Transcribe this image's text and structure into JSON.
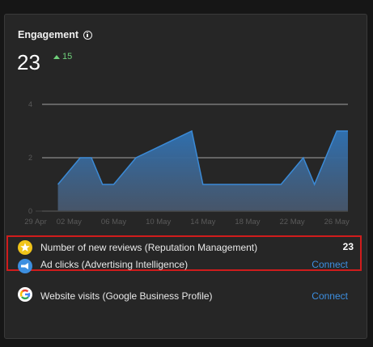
{
  "widget": {
    "title": "Engagement",
    "total": "23",
    "delta": "15",
    "colors": {
      "accent": "#3d8fe0",
      "positive": "#6fcf7a",
      "highlight": "#d01c1c",
      "area": "#2f6fae"
    }
  },
  "chart_data": {
    "type": "area",
    "x": [
      "29 Apr",
      "30 Apr",
      "01 May",
      "02 May",
      "03 May",
      "04 May",
      "05 May",
      "06 May",
      "07 May",
      "08 May",
      "09 May",
      "10 May",
      "11 May",
      "12 May",
      "13 May",
      "14 May",
      "15 May",
      "16 May",
      "17 May",
      "18 May",
      "19 May",
      "20 May",
      "21 May",
      "22 May",
      "23 May",
      "24 May",
      "25 May",
      "26 May",
      "27 May"
    ],
    "values": [
      null,
      null,
      1,
      1.5,
      2,
      2,
      1,
      1,
      1.5,
      2,
      2.2,
      2.4,
      2.6,
      2.8,
      3,
      1,
      1,
      1,
      1,
      1,
      1,
      1,
      1,
      1.5,
      2,
      1,
      2,
      3,
      3
    ],
    "x_tick_labels": [
      "29 Apr",
      "02 May",
      "06 May",
      "10 May",
      "14 May",
      "18 May",
      "22 May",
      "26 May"
    ],
    "y_tick_labels": [
      "0",
      "2",
      "4"
    ],
    "ylim": [
      0,
      4
    ],
    "grid": true,
    "title": "",
    "xlabel": "",
    "ylabel": ""
  },
  "rows": [
    {
      "icon": "star-icon",
      "label": "Number of new reviews (Reputation Management)",
      "value": "23"
    },
    {
      "icon": "megaphone-icon",
      "label": "Ad clicks (Advertising Intelligence)",
      "action": "Connect"
    },
    {
      "icon": "google-icon",
      "label": "Website visits (Google Business Profile)",
      "action": "Connect"
    }
  ]
}
